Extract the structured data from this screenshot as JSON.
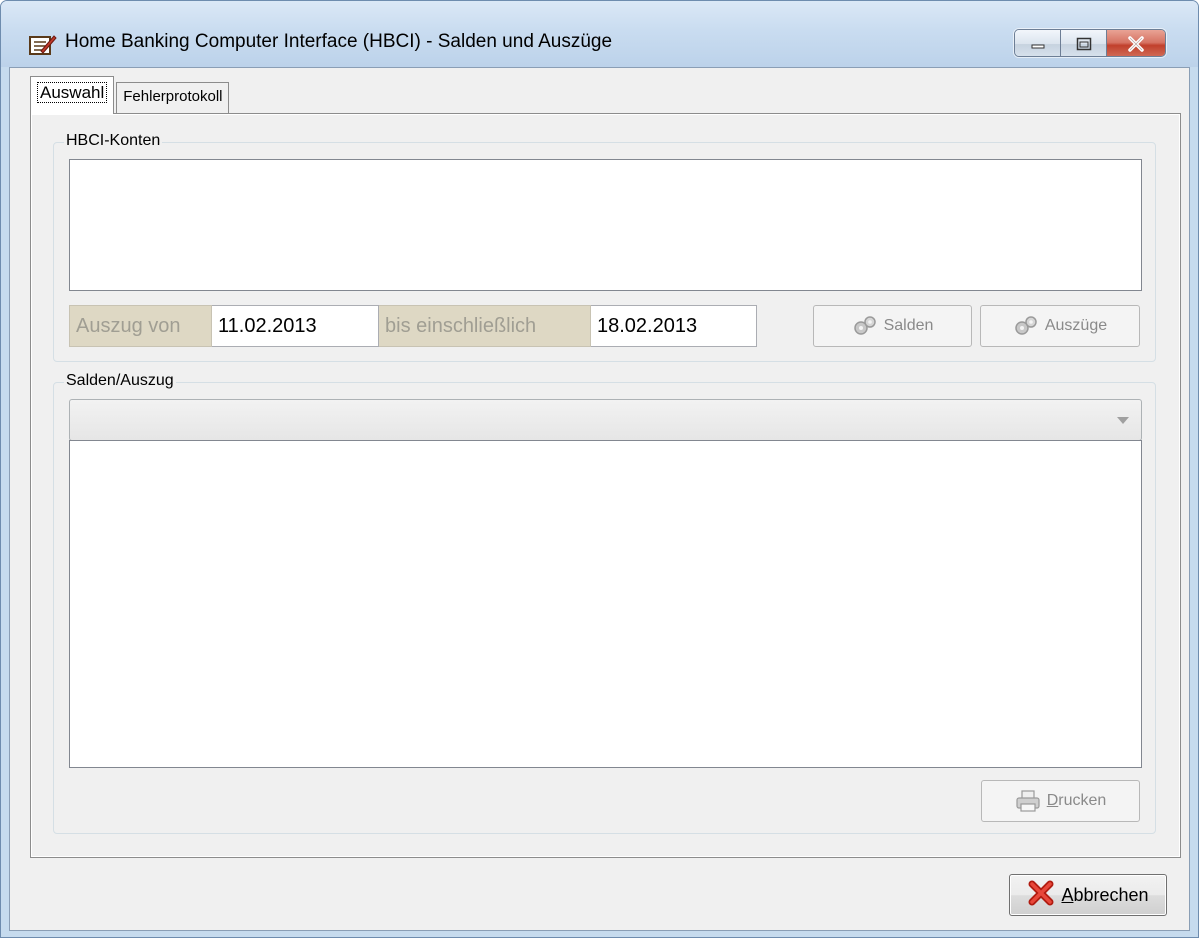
{
  "window": {
    "title": "Home Banking Computer Interface (HBCI) - Salden und Auszüge"
  },
  "tabs": [
    {
      "label": "Auswahl",
      "active": true
    },
    {
      "label": "Fehlerprotokoll",
      "active": false
    }
  ],
  "accounts_group": {
    "title": "HBCI-Konten",
    "from_label": "Auszug von",
    "from_value": "11.02.2013",
    "to_label": "bis einschließlich",
    "to_value": "18.02.2013",
    "balances_button": "Salden",
    "statements_button": "Auszüge"
  },
  "statement_group": {
    "title": "Salden/Auszug",
    "selected_value": "",
    "print_button_first": "D",
    "print_button_rest": "rucken"
  },
  "footer": {
    "cancel_first": "A",
    "cancel_rest": "bbrechen"
  },
  "colors": {
    "label_bg": "#ded8c4",
    "disabled_text": "#8a8a8a",
    "close_button": "#c1402c"
  }
}
